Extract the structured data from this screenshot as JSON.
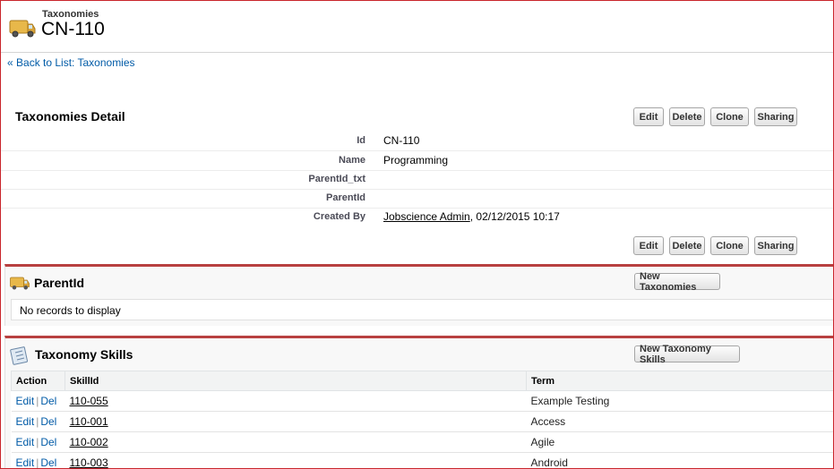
{
  "header": {
    "object_type": "Taxonomies",
    "record_name": "CN-110",
    "back_prefix": "« ",
    "back_link": "Back to List: Taxonomies"
  },
  "detail": {
    "title": "Taxonomies Detail",
    "buttons": {
      "edit": "Edit",
      "delete": "Delete",
      "clone": "Clone",
      "sharing": "Sharing"
    },
    "fields": [
      {
        "label": "Id",
        "value": "CN-110"
      },
      {
        "label": "Name",
        "value": "Programming"
      },
      {
        "label": "ParentId_txt",
        "value": ""
      },
      {
        "label": "ParentId",
        "value": ""
      },
      {
        "label": "Created By",
        "value": "Jobscience Admin",
        "suffix": ", 02/12/2015 10:17"
      }
    ]
  },
  "parent_list": {
    "title": "ParentId",
    "new_button": "New Taxonomies",
    "empty_text": "No records to display"
  },
  "skills_list": {
    "title": "Taxonomy Skills",
    "new_button": "New Taxonomy Skills",
    "columns": [
      "Action",
      "SkillId",
      "Term"
    ],
    "action_edit": "Edit",
    "action_sep": "|",
    "action_del": "Del",
    "rows": [
      {
        "skill_id": "110-055",
        "term": "Example Testing"
      },
      {
        "skill_id": "110-001",
        "term": "Access"
      },
      {
        "skill_id": "110-002",
        "term": "Agile"
      },
      {
        "skill_id": "110-003",
        "term": "Android"
      }
    ]
  },
  "colors": {
    "accent_border": "#c9252c",
    "link": "#015ba7",
    "section_bar": "#b84040"
  }
}
